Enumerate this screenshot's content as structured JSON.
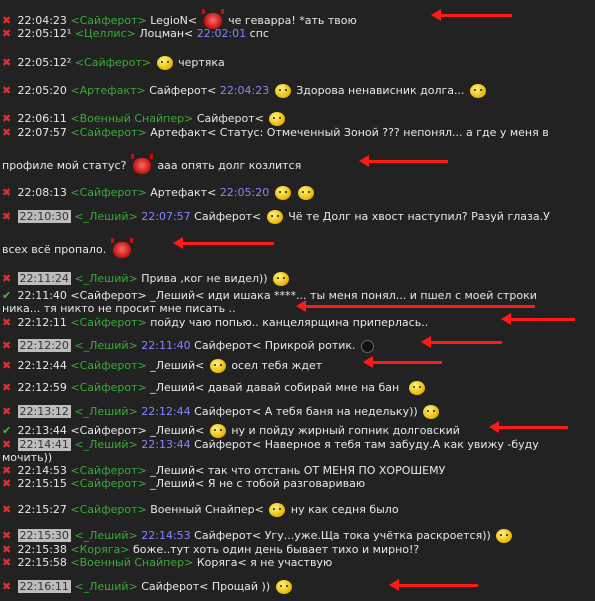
{
  "icons": {
    "delete": "✖",
    "check": "✔",
    "smile": "smiley-icon",
    "devil": "devil-icon",
    "bomb": "bomb-icon"
  },
  "colors": {
    "background": "#222222",
    "nick": "#3aaa3a",
    "timestamp_ref": "#8585ff",
    "delete_icon": "#e03030",
    "check_icon": "#3cc040",
    "arrow": "#ff1a1a",
    "highlight_time": "#bdbdbd"
  },
  "messages": [
    {
      "t": "22:04:23",
      "n": "<Сайферот>",
      "a": "LegioN<",
      "b": "че геварра! *ать твою"
    },
    {
      "t": "22:05:12¹",
      "n": "<Целлис>",
      "a": "Лоцман<",
      "r": "22:02:01",
      "b": "спс"
    },
    {
      "t": "22:05:12²",
      "n": "<Сайферот>",
      "b": "чертяка"
    },
    {
      "t": "22:05:20",
      "n": "<Артефакт>",
      "a": "Сайферот<",
      "r": "22:04:23",
      "b": "Здорова ненависник долга..."
    },
    {
      "t": "22:06:11",
      "n": "<Военный Снайпер>",
      "a": "Сайферот<"
    },
    {
      "t": "22:07:57",
      "n": "<Сайферот>",
      "a": "Артефакт< Статус: Отмеченный Зоной ??? непонял... а где у меня в",
      "w": "профиле мой статус?",
      "b": "ааа опять долг козлится"
    },
    {
      "t": "22:08:13",
      "n": "<Сайферот>",
      "a": "Артефакт<",
      "r": "22:05:20"
    },
    {
      "t": "22:10:30",
      "n": "<_Леший>",
      "r": "22:07:57",
      "a": "Сайферот<",
      "b": "Чё те Долг на хвост наступил? Разуй глаза.У",
      "w": "всех всё пропало."
    },
    {
      "t": "22:11:24",
      "n": "<_Леший>",
      "a": "Прива ,ког не видел))"
    },
    {
      "t": "22:11:40",
      "n": "<Сайферот>",
      "a": "_Леший< иди ишака ****... ты меня понял... и пшел с моей строки",
      "w": "ника... тя никто не просит мне писать .."
    },
    {
      "t": "22:12:11",
      "n": "<Сайферот>",
      "a": "пойду чаю попью.. канцелярщина приперлась.."
    },
    {
      "t": "22:12:20",
      "n": "<_Леший>",
      "r": "22:11:40",
      "a": "Сайферот< Прикрой ротик."
    },
    {
      "t": "22:12:44",
      "n": "<Сайферот>",
      "a": "_Леший<",
      "b": "осел тебя ждет"
    },
    {
      "t": "22:12:59",
      "n": "<Сайферот>",
      "a": "_Леший< давай давай собирай мне на бан"
    },
    {
      "t": "22:13:12",
      "n": "<_Леший>",
      "r": "22:12:44",
      "a": "Сайферот< А тебя баня на недельку))"
    },
    {
      "t": "22:13:44",
      "n": "<Сайферот>",
      "a": "_Леший<",
      "b": "ну и пойду жирный гопник долговский"
    },
    {
      "t": "22:14:41",
      "n": "<_Леший>",
      "r": "22:13:44",
      "a": "Сайферот< Наверное я тебя там забуду.А как увижу -буду",
      "w": "мочить))"
    },
    {
      "t": "22:14:53",
      "n": "<Сайферот>",
      "a": "_Леший< так что отстань ОТ МЕНЯ ПО ХОРОШЕМУ"
    },
    {
      "t": "22:15:15",
      "n": "<Сайферот>",
      "a": "_Леший< Я не с тобой разговариваю"
    },
    {
      "t": "22:15:27",
      "n": "<Сайферот>",
      "a": "Военный Снайпер<",
      "b": "ну как седня было"
    },
    {
      "t": "22:15:30",
      "n": "<_Леший>",
      "r": "22:14:53",
      "a": "Сайферот< Угу...уже.Ща тока учётка раскроется))"
    },
    {
      "t": "22:15:38",
      "n": "<Коряга>",
      "a": "боже..тут хоть один день бывает тихо и мирно!?"
    },
    {
      "t": "22:15:58",
      "n": "<Военный Снайпер>",
      "a": "Коряга< я не участвую"
    },
    {
      "t": "22:16:11",
      "n": "<_Леший>",
      "a": "Сайферот< Прощай ))"
    }
  ]
}
